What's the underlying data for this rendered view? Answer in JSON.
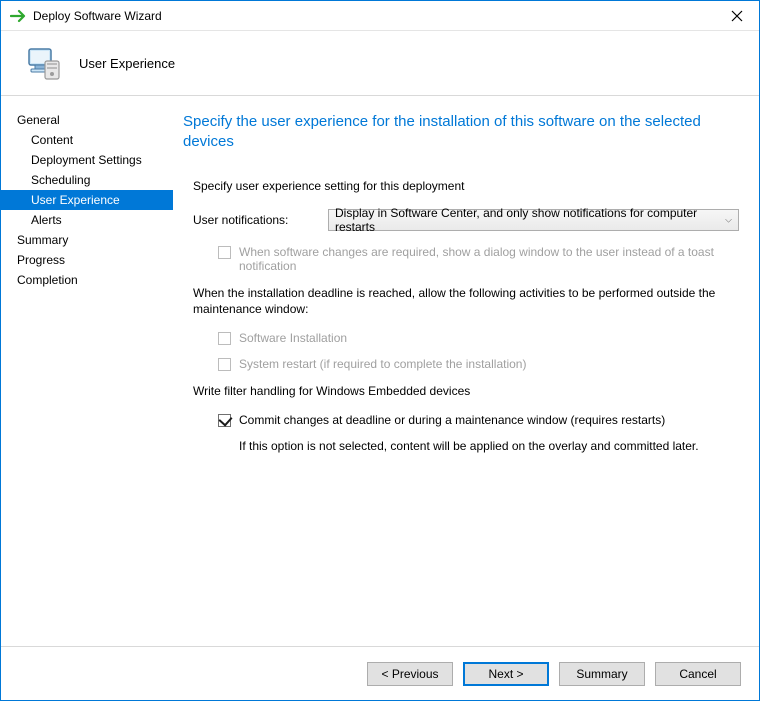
{
  "window": {
    "title": "Deploy Software Wizard"
  },
  "header": {
    "page_name": "User Experience"
  },
  "sidebar": {
    "items": [
      {
        "label": "General",
        "child": false,
        "selected": false
      },
      {
        "label": "Content",
        "child": true,
        "selected": false
      },
      {
        "label": "Deployment Settings",
        "child": true,
        "selected": false
      },
      {
        "label": "Scheduling",
        "child": true,
        "selected": false
      },
      {
        "label": "User Experience",
        "child": true,
        "selected": true
      },
      {
        "label": "Alerts",
        "child": true,
        "selected": false
      },
      {
        "label": "Summary",
        "child": false,
        "selected": false
      },
      {
        "label": "Progress",
        "child": false,
        "selected": false
      },
      {
        "label": "Completion",
        "child": false,
        "selected": false
      }
    ]
  },
  "content": {
    "heading": "Specify the user experience for the installation of this software on the selected devices",
    "section1_label": "Specify user experience setting for this deployment",
    "notifications_label": "User notifications:",
    "notifications_value": "Display in Software Center, and only show notifications for computer restarts",
    "dialog_checkbox_label": "When software changes are required, show a dialog window to the user instead of a toast notification",
    "deadline_text": "When the installation deadline is reached, allow the following activities to be performed outside the maintenance window:",
    "software_install_label": "Software Installation",
    "system_restart_label": "System restart  (if required to complete the installation)",
    "embedded_heading": "Write filter handling for Windows Embedded devices",
    "commit_label": "Commit changes at deadline or during a maintenance window (requires restarts)",
    "commit_info": "If this option is not selected, content will be applied on the overlay and committed later."
  },
  "footer": {
    "previous": "< Previous",
    "next": "Next >",
    "summary": "Summary",
    "cancel": "Cancel"
  }
}
